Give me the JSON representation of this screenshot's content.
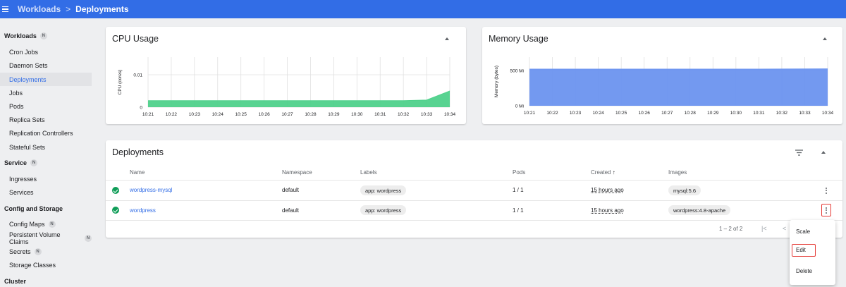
{
  "topbar": {
    "parent": "Workloads",
    "separator": ">",
    "current": "Deployments"
  },
  "sidebar": {
    "sections": [
      {
        "label": "Workloads",
        "badge": "N"
      },
      {
        "label": "Service",
        "badge": "N"
      },
      {
        "label": "Config and Storage",
        "badge": ""
      },
      {
        "label": "Cluster",
        "badge": ""
      }
    ],
    "items": [
      {
        "label": "Cron Jobs",
        "badge": ""
      },
      {
        "label": "Daemon Sets",
        "badge": ""
      },
      {
        "label": "Deployments",
        "badge": ""
      },
      {
        "label": "Jobs",
        "badge": ""
      },
      {
        "label": "Pods",
        "badge": ""
      },
      {
        "label": "Replica Sets",
        "badge": ""
      },
      {
        "label": "Replication Controllers",
        "badge": ""
      },
      {
        "label": "Stateful Sets",
        "badge": ""
      },
      {
        "label": "Ingresses",
        "badge": ""
      },
      {
        "label": "Services",
        "badge": ""
      },
      {
        "label": "Config Maps",
        "badge": "N"
      },
      {
        "label": "Persistent Volume Claims",
        "badge": "N"
      },
      {
        "label": "Secrets",
        "badge": "N"
      },
      {
        "label": "Storage Classes",
        "badge": ""
      }
    ]
  },
  "cpu_card": {
    "title": "CPU Usage"
  },
  "memory_card": {
    "title": "Memory Usage"
  },
  "chart_data": [
    {
      "type": "area",
      "title": "CPU Usage",
      "ylabel": "CPU (cores)",
      "xlabel": "",
      "x": [
        "10:21",
        "10:22",
        "10:23",
        "10:24",
        "10:25",
        "10:26",
        "10:27",
        "10:28",
        "10:29",
        "10:30",
        "10:31",
        "10:32",
        "10:33",
        "10:34"
      ],
      "values": [
        0.002,
        0.002,
        0.002,
        0.002,
        0.002,
        0.002,
        0.002,
        0.002,
        0.002,
        0.002,
        0.002,
        0.002,
        0.0022,
        0.005
      ],
      "ytick_labels": [
        "0",
        "0.01"
      ],
      "ytick_values": [
        0,
        0.01
      ],
      "ylim": [
        0,
        0.01
      ],
      "grid": true,
      "color": "#4fd18b"
    },
    {
      "type": "area",
      "title": "Memory Usage",
      "ylabel": "Memory (bytes)",
      "xlabel": "",
      "x": [
        "10:21",
        "10:22",
        "10:23",
        "10:24",
        "10:25",
        "10:26",
        "10:27",
        "10:28",
        "10:29",
        "10:30",
        "10:31",
        "10:32",
        "10:33",
        "10:34"
      ],
      "values": [
        520,
        520,
        520,
        520,
        520,
        520,
        520,
        520,
        520,
        520,
        520,
        521,
        522,
        524
      ],
      "ytick_labels": [
        "0 Mi",
        "500 Mi"
      ],
      "ytick_values": [
        0,
        500
      ],
      "ylim": [
        0,
        500
      ],
      "grid": true,
      "color": "#6b93ef"
    }
  ],
  "deployments": {
    "title": "Deployments",
    "columns": {
      "name": "Name",
      "namespace": "Namespace",
      "labels": "Labels",
      "pods": "Pods",
      "created": "Created",
      "images": "Images"
    },
    "sort_arrow": "↑",
    "rows": [
      {
        "name": "wordpress-mysql",
        "namespace": "default",
        "label": "app: wordpress",
        "pods": "1 / 1",
        "created": "15 hours ago",
        "image": "mysql:5.6"
      },
      {
        "name": "wordpress",
        "namespace": "default",
        "label": "app: wordpress",
        "pods": "1 / 1",
        "created": "15 hours ago",
        "image": "wordpress:4.8-apache"
      }
    ],
    "pagination": {
      "range": "1 – 2 of 2",
      "first": "|<",
      "prev": "<"
    }
  },
  "context_menu": {
    "scale": "Scale",
    "edit": "Edit",
    "delete": "Delete"
  },
  "colors": {
    "topbar": "#326de6",
    "accent": "#326de6",
    "highlight": "#e53935",
    "success": "#0f9d58"
  }
}
